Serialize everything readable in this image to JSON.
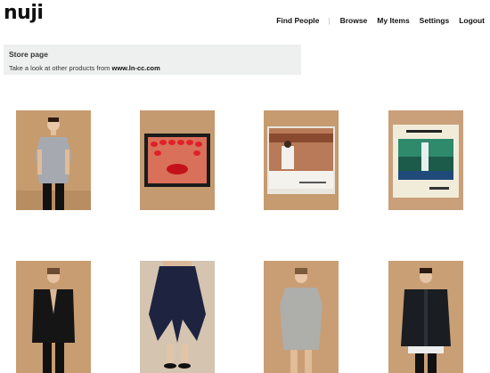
{
  "header": {
    "logo": "nuji",
    "nav": [
      {
        "label": "Find People"
      },
      {
        "label": "Browse"
      },
      {
        "label": "My Items"
      },
      {
        "label": "Settings"
      },
      {
        "label": "Logout"
      }
    ]
  },
  "store": {
    "title": "Store page",
    "description_prefix": "Take a look at other products from",
    "store_link": "www.ln-cc.com"
  },
  "products": [
    {
      "image": "man-grey-sleeveless-top"
    },
    {
      "image": "red-lips-nails-book"
    },
    {
      "image": "my-favorite-things-record"
    },
    {
      "image": "waterfall-record-cover"
    },
    {
      "image": "woman-black-jacket"
    },
    {
      "image": "navy-drape-trousers"
    },
    {
      "image": "woman-grey-tunic"
    },
    {
      "image": "man-black-bomber"
    }
  ]
}
